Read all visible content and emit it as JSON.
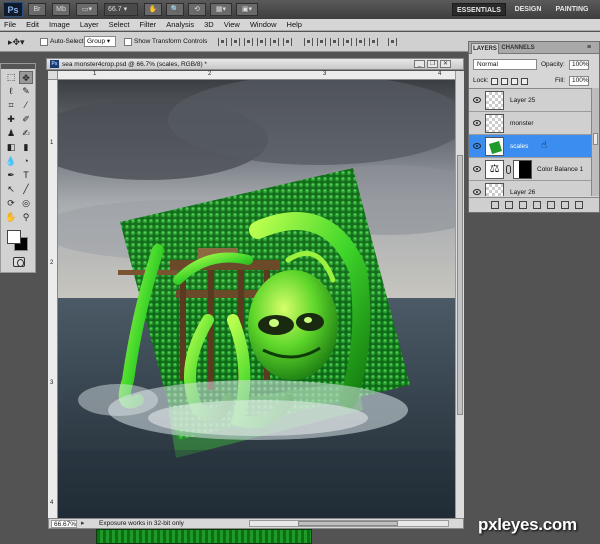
{
  "app": {
    "logo": "Ps",
    "zoom": "66.7",
    "workspaces": [
      "ESSENTIALS",
      "DESIGN",
      "PAINTING"
    ]
  },
  "menu": [
    "File",
    "Edit",
    "Image",
    "Layer",
    "Select",
    "Filter",
    "Analysis",
    "3D",
    "View",
    "Window",
    "Help"
  ],
  "options": {
    "auto_select_label": "Auto-Select:",
    "auto_select_value": "Group",
    "show_transform_label": "Show Transform Controls"
  },
  "document": {
    "title": "sea monster4crop.psd @ 66.7% (scales, RGB/8) *",
    "zoom": "66.67%",
    "status": "Exposure works in 32-bit only",
    "ruler_marks": [
      "1",
      "2",
      "3",
      "4"
    ]
  },
  "layers_panel": {
    "tabs": [
      "LAYERS",
      "CHANNELS"
    ],
    "blend_mode": "Normal",
    "opacity_label": "Opacity:",
    "opacity": "100%",
    "lock_label": "Lock:",
    "fill_label": "Fill:",
    "fill": "100%",
    "layers": [
      {
        "name": "Layer 25"
      },
      {
        "name": "monster"
      },
      {
        "name": "scales",
        "selected": true
      },
      {
        "name": "Color Balance 1"
      },
      {
        "name": "Layer 26"
      }
    ]
  },
  "watermark": "pxleyes.com",
  "colors": {
    "accent_selected": "#3b8ef0",
    "scales_green": "#1f9a2a",
    "tentacle_green": "#3fd62a"
  }
}
